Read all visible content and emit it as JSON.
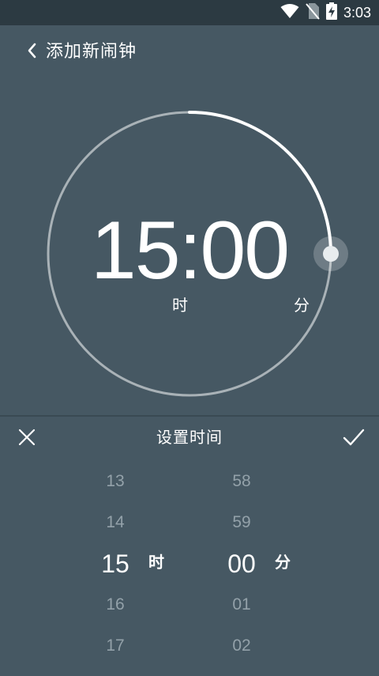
{
  "status_bar": {
    "time": "3:03",
    "icons": [
      "wifi-icon",
      "no-sim-icon",
      "battery-charging-icon"
    ]
  },
  "header": {
    "back_icon": "chevron-left-icon",
    "title": "添加新闹钟"
  },
  "dial": {
    "hours": "15",
    "minutes": "00",
    "separator": ":",
    "hour_unit": "时",
    "minute_unit": "分",
    "progress_fraction": 0.25
  },
  "picker": {
    "cancel_icon": "close-icon",
    "title": "设置时间",
    "confirm_icon": "check-icon",
    "hours": [
      "13",
      "14",
      "15",
      "16",
      "17"
    ],
    "selected_hour": "15",
    "hour_label": "时",
    "minutes": [
      "58",
      "59",
      "00",
      "01",
      "02"
    ],
    "selected_minute": "00",
    "minute_label": "分"
  },
  "colors": {
    "background": "#465863",
    "status_bar": "#2c3a42",
    "ring_track": "#a9b2b7",
    "ring_progress": "#ffffff",
    "muted_text": "#93a1a9"
  }
}
